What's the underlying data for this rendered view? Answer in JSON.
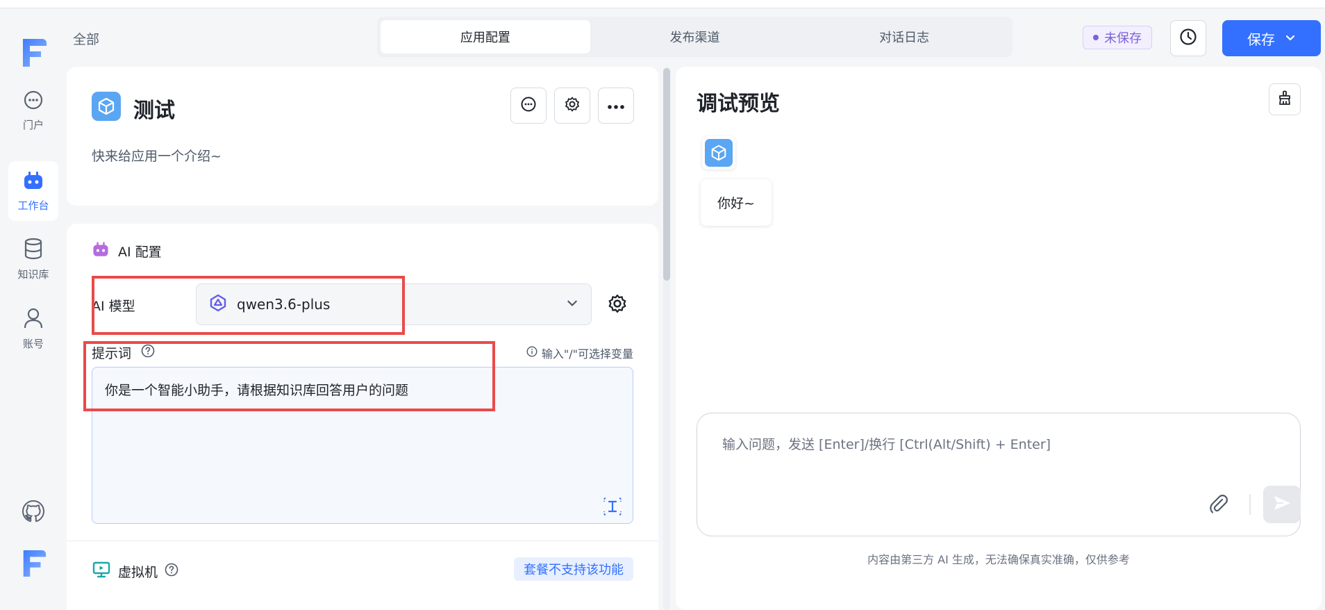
{
  "header": {
    "breadcrumb": "全部",
    "tabs": [
      {
        "label": "应用配置",
        "active": true
      },
      {
        "label": "发布渠道",
        "active": false
      },
      {
        "label": "对话日志",
        "active": false
      }
    ],
    "status_badge": "未保存",
    "save_label": "保存"
  },
  "sidebar": {
    "items": [
      {
        "label": "门户",
        "icon": "chat-bubble-icon"
      },
      {
        "label": "工作台",
        "icon": "robot-icon",
        "active": true
      },
      {
        "label": "知识库",
        "icon": "database-icon"
      },
      {
        "label": "账号",
        "icon": "user-icon"
      }
    ]
  },
  "app": {
    "title": "测试",
    "description": "快来给应用一个介绍~"
  },
  "ai_config": {
    "section_title": "AI 配置",
    "model_label": "AI 模型",
    "model_value": "qwen3.6-plus",
    "prompt_label": "提示词",
    "prompt_hint": "输入\"/\"可选择变量",
    "prompt_value": "你是一个智能小助手，请根据知识库回答用户的问题"
  },
  "vm": {
    "label": "虚拟机",
    "badge": "套餐不支持该功能"
  },
  "preview": {
    "title": "调试预览",
    "greeting": "你好~",
    "input_placeholder": "输入问题，发送 [Enter]/换行 [Ctrl(Alt/Shift) + Enter]",
    "disclaimer": "内容由第三方 AI 生成，无法确保真实准确，仅供参考"
  },
  "colors": {
    "accent": "#3370ff",
    "annotation": "#ea4a4a",
    "unsaved": "#7a63d8",
    "app_icon": "#5aa6f3"
  }
}
